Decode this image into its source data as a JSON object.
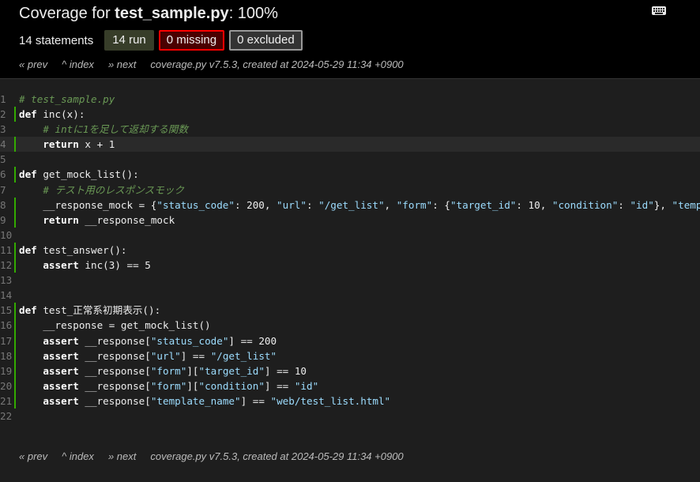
{
  "header": {
    "title_prefix": "Coverage for ",
    "title_file": "test_sample.py",
    "title_suffix": ": 100%",
    "statements": "14 statements",
    "run_label": "14 run",
    "missing_label": "0 missing",
    "excluded_label": "0 excluded"
  },
  "nav": {
    "prev": "« prev",
    "index": "^ index",
    "next": "» next",
    "created": "coverage.py v7.5.3, created at 2024-05-29 11:34 +0900"
  },
  "icons": {
    "keyboard": "keyboard-icon"
  },
  "colors": {
    "run_bar": "#33aa00",
    "missing_border": "#ff0000",
    "comment": "#6a9955",
    "string": "#9cdcfe"
  },
  "source": [
    {
      "n": "1",
      "run": false,
      "tokens": [
        {
          "t": "# test_sample.py",
          "c": "com"
        }
      ]
    },
    {
      "n": "2",
      "run": true,
      "tokens": [
        {
          "t": "def",
          "c": "kw"
        },
        {
          "t": " inc(x):",
          "c": "nm"
        }
      ]
    },
    {
      "n": "3",
      "run": false,
      "tokens": [
        {
          "t": "    ",
          "c": "nm"
        },
        {
          "t": "# intに1を足して返却する関数",
          "c": "com"
        }
      ]
    },
    {
      "n": "4",
      "run": true,
      "cur": true,
      "tokens": [
        {
          "t": "    ",
          "c": "nm"
        },
        {
          "t": "return",
          "c": "kw"
        },
        {
          "t": " x + 1",
          "c": "nm"
        }
      ]
    },
    {
      "n": "5",
      "run": false,
      "tokens": []
    },
    {
      "n": "6",
      "run": true,
      "tokens": [
        {
          "t": "def",
          "c": "kw"
        },
        {
          "t": " get_mock_list():",
          "c": "nm"
        }
      ]
    },
    {
      "n": "7",
      "run": false,
      "tokens": [
        {
          "t": "    ",
          "c": "nm"
        },
        {
          "t": "# テスト用のレスポンスモック",
          "c": "com"
        }
      ]
    },
    {
      "n": "8",
      "run": true,
      "tokens": [
        {
          "t": "    __response_mock = {",
          "c": "nm"
        },
        {
          "t": "\"status_code\"",
          "c": "str"
        },
        {
          "t": ": 200, ",
          "c": "nm"
        },
        {
          "t": "\"url\"",
          "c": "str"
        },
        {
          "t": ": ",
          "c": "nm"
        },
        {
          "t": "\"/get_list\"",
          "c": "str"
        },
        {
          "t": ", ",
          "c": "nm"
        },
        {
          "t": "\"form\"",
          "c": "str"
        },
        {
          "t": ": {",
          "c": "nm"
        },
        {
          "t": "\"target_id\"",
          "c": "str"
        },
        {
          "t": ": 10, ",
          "c": "nm"
        },
        {
          "t": "\"condition\"",
          "c": "str"
        },
        {
          "t": ": ",
          "c": "nm"
        },
        {
          "t": "\"id\"",
          "c": "str"
        },
        {
          "t": "}, ",
          "c": "nm"
        },
        {
          "t": "\"templ",
          "c": "str"
        }
      ]
    },
    {
      "n": "9",
      "run": true,
      "tokens": [
        {
          "t": "    ",
          "c": "nm"
        },
        {
          "t": "return",
          "c": "kw"
        },
        {
          "t": " __response_mock",
          "c": "nm"
        }
      ]
    },
    {
      "n": "10",
      "run": false,
      "tokens": []
    },
    {
      "n": "11",
      "run": true,
      "tokens": [
        {
          "t": "def",
          "c": "kw"
        },
        {
          "t": " test_answer():",
          "c": "nm"
        }
      ]
    },
    {
      "n": "12",
      "run": true,
      "tokens": [
        {
          "t": "    ",
          "c": "nm"
        },
        {
          "t": "assert",
          "c": "kw"
        },
        {
          "t": " inc(3) == 5",
          "c": "nm"
        }
      ]
    },
    {
      "n": "13",
      "run": false,
      "tokens": []
    },
    {
      "n": "14",
      "run": false,
      "tokens": []
    },
    {
      "n": "15",
      "run": true,
      "tokens": [
        {
          "t": "def",
          "c": "kw"
        },
        {
          "t": " test_正常系初期表示():",
          "c": "nm"
        }
      ]
    },
    {
      "n": "16",
      "run": true,
      "tokens": [
        {
          "t": "    __response = get_mock_list()",
          "c": "nm"
        }
      ]
    },
    {
      "n": "17",
      "run": true,
      "tokens": [
        {
          "t": "    ",
          "c": "nm"
        },
        {
          "t": "assert",
          "c": "kw"
        },
        {
          "t": " __response[",
          "c": "nm"
        },
        {
          "t": "\"status_code\"",
          "c": "str"
        },
        {
          "t": "] == 200",
          "c": "nm"
        }
      ]
    },
    {
      "n": "18",
      "run": true,
      "tokens": [
        {
          "t": "    ",
          "c": "nm"
        },
        {
          "t": "assert",
          "c": "kw"
        },
        {
          "t": " __response[",
          "c": "nm"
        },
        {
          "t": "\"url\"",
          "c": "str"
        },
        {
          "t": "] == ",
          "c": "nm"
        },
        {
          "t": "\"/get_list\"",
          "c": "str"
        }
      ]
    },
    {
      "n": "19",
      "run": true,
      "tokens": [
        {
          "t": "    ",
          "c": "nm"
        },
        {
          "t": "assert",
          "c": "kw"
        },
        {
          "t": " __response[",
          "c": "nm"
        },
        {
          "t": "\"form\"",
          "c": "str"
        },
        {
          "t": "][",
          "c": "nm"
        },
        {
          "t": "\"target_id\"",
          "c": "str"
        },
        {
          "t": "] == 10",
          "c": "nm"
        }
      ]
    },
    {
      "n": "20",
      "run": true,
      "tokens": [
        {
          "t": "    ",
          "c": "nm"
        },
        {
          "t": "assert",
          "c": "kw"
        },
        {
          "t": " __response[",
          "c": "nm"
        },
        {
          "t": "\"form\"",
          "c": "str"
        },
        {
          "t": "][",
          "c": "nm"
        },
        {
          "t": "\"condition\"",
          "c": "str"
        },
        {
          "t": "] == ",
          "c": "nm"
        },
        {
          "t": "\"id\"",
          "c": "str"
        }
      ]
    },
    {
      "n": "21",
      "run": true,
      "tokens": [
        {
          "t": "    ",
          "c": "nm"
        },
        {
          "t": "assert",
          "c": "kw"
        },
        {
          "t": " __response[",
          "c": "nm"
        },
        {
          "t": "\"template_name\"",
          "c": "str"
        },
        {
          "t": "] == ",
          "c": "nm"
        },
        {
          "t": "\"web/test_list.html\"",
          "c": "str"
        }
      ]
    },
    {
      "n": "22",
      "run": false,
      "tokens": []
    }
  ]
}
